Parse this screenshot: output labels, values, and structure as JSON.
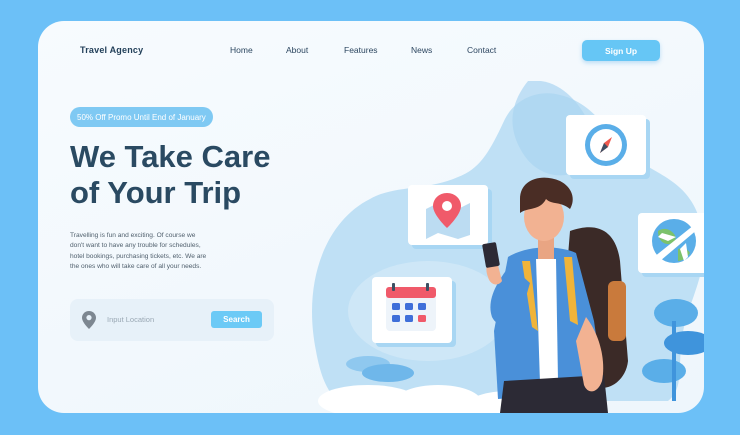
{
  "header": {
    "brand": "Travel Agency",
    "nav": [
      "Home",
      "About",
      "Features",
      "News",
      "Contact"
    ],
    "signup_label": "Sign Up"
  },
  "hero": {
    "promo": "50% Off Promo Until End of January",
    "title_line1": "We Take Care",
    "title_line2": "of Your Trip",
    "description": "Travelling is fun and exciting. Of course we don't want to have any trouble for schedules, hotel bookings, purchasing tickets, etc. We are the ones who will take care of all your needs."
  },
  "search": {
    "placeholder": "Input Location",
    "button_label": "Search"
  },
  "colors": {
    "background": "#6cc0f7",
    "accent": "#66c6f5",
    "heading": "#2a4a62"
  },
  "illustration": {
    "icons": [
      "compass-icon",
      "map-pin-icon",
      "calendar-icon",
      "globe-airplane-icon"
    ]
  }
}
